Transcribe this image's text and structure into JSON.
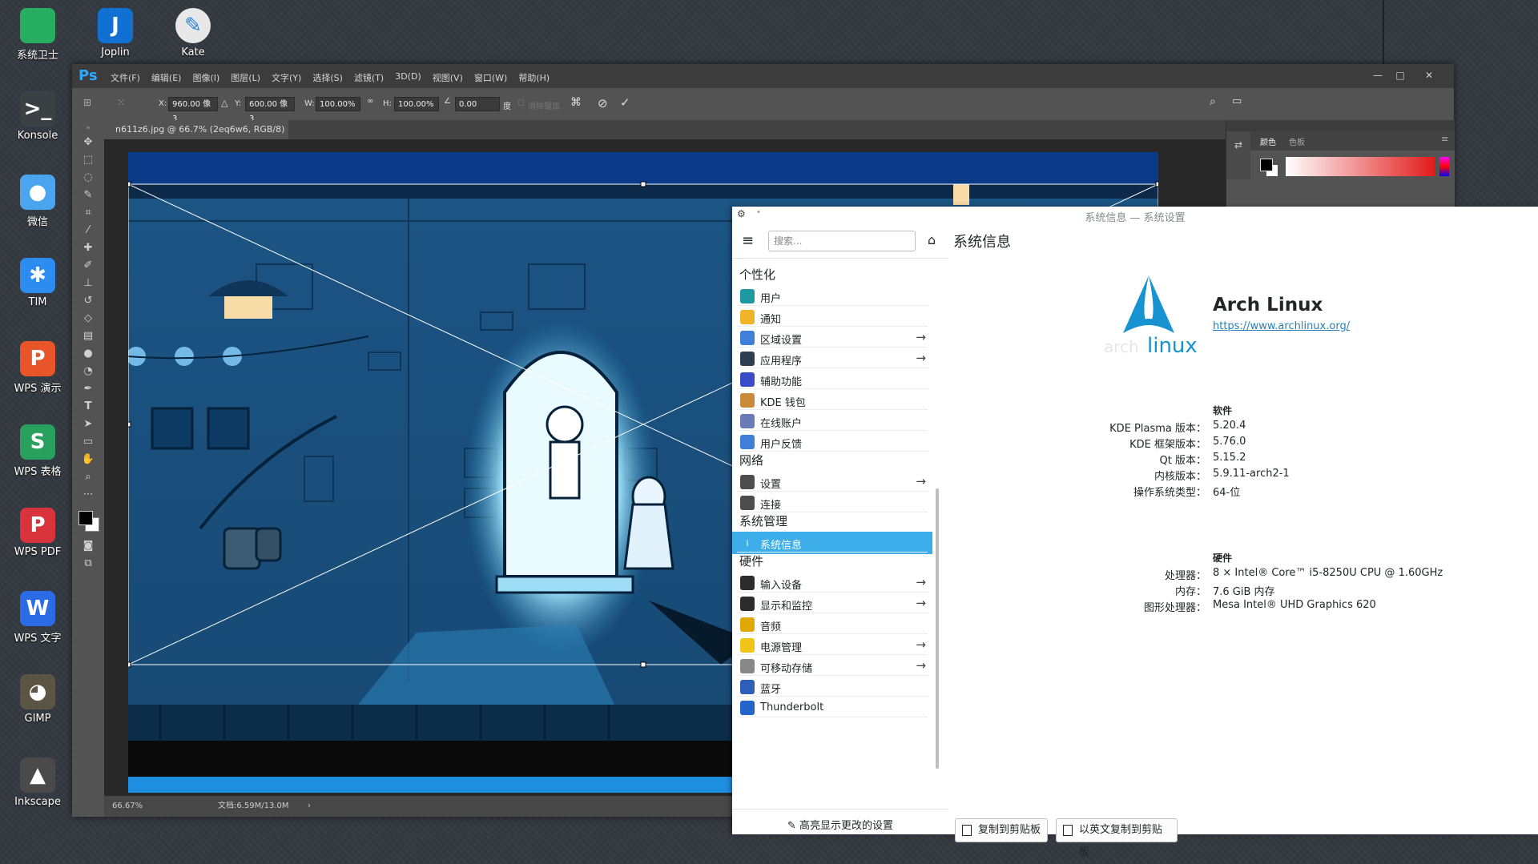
{
  "desktop": {
    "icons": [
      {
        "label": "系统卫士",
        "icon": "shield-folder-icon",
        "color": "#27ae60",
        "glyph": ""
      },
      {
        "label": "Konsole",
        "icon": "terminal-icon",
        "color": "#3b4045",
        "glyph": ">_"
      },
      {
        "label": "微信",
        "icon": "wechat-icon",
        "color": "#4aa4ee",
        "glyph": "●"
      },
      {
        "label": "TIM",
        "icon": "tim-icon",
        "color": "#2d8cf0",
        "glyph": "✱"
      },
      {
        "label": "WPS 演示",
        "icon": "wps-presentation-icon",
        "color": "#e8552a",
        "glyph": "P"
      },
      {
        "label": "WPS 表格",
        "icon": "wps-spreadsheet-icon",
        "color": "#2aa05e",
        "glyph": "S"
      },
      {
        "label": "WPS PDF",
        "icon": "wps-pdf-icon",
        "color": "#d9333b",
        "glyph": "P"
      },
      {
        "label": "WPS 文字",
        "icon": "wps-writer-icon",
        "color": "#2b6ce6",
        "glyph": "W"
      },
      {
        "label": "GIMP",
        "icon": "gimp-icon",
        "color": "#5c5543",
        "glyph": "◕"
      },
      {
        "label": "Inkscape",
        "icon": "inkscape-icon",
        "color": "#4a4a4a",
        "glyph": "▲"
      }
    ],
    "top_icons": [
      {
        "label": "Joplin",
        "icon": "joplin-icon",
        "color": "#1071d3",
        "glyph": "J"
      },
      {
        "label": "Kate",
        "icon": "kate-icon",
        "color": "#e8e8e8",
        "glyph": "✎"
      }
    ]
  },
  "photoshop": {
    "logo": "Ps",
    "menus": [
      "文件(F)",
      "编辑(E)",
      "图像(I)",
      "图层(L)",
      "文字(Y)",
      "选择(S)",
      "滤镜(T)",
      "3D(D)",
      "视图(V)",
      "窗口(W)",
      "帮助(H)"
    ],
    "options": {
      "x_label": "X:",
      "x_value": "960.00 像3",
      "y_label": "Y:",
      "y_value": "600.00 像3",
      "w_label": "W:",
      "w_value": "100.00%",
      "h_label": "H:",
      "h_value": "100.00%",
      "angle_value": "0.00",
      "angle_unit": "度",
      "antialias_label": "消除锯齿"
    },
    "document_tab": "n611z6.jpg @ 66.7% (2eq6w6, RGB/8)",
    "status": {
      "zoom": "66.67%",
      "doc": "文档:6.59M/13.0M"
    },
    "panel_tabs": [
      "颜色",
      "色板"
    ]
  },
  "settings": {
    "window_title": "系统信息 — 系统设置",
    "search_placeholder": "搜索...",
    "sidebar": {
      "sections": [
        {
          "title": "个性化",
          "items": [
            {
              "label": "用户",
              "icon": "user-icon",
              "color": "#1d99a1",
              "arrow": false
            },
            {
              "label": "通知",
              "icon": "bell-icon",
              "color": "#f0b429",
              "arrow": false
            },
            {
              "label": "区域设置",
              "icon": "locale-icon",
              "color": "#3d7fd9",
              "arrow": true
            },
            {
              "label": "应用程序",
              "icon": "apps-icon",
              "color": "#2c3e50",
              "arrow": true
            },
            {
              "label": "辅助功能",
              "icon": "accessibility-icon",
              "color": "#3a4bc7",
              "arrow": false
            },
            {
              "label": "KDE 钱包",
              "icon": "wallet-icon",
              "color": "#c98a3c",
              "arrow": false
            },
            {
              "label": "在线账户",
              "icon": "online-accounts-icon",
              "color": "#6b7bb8",
              "arrow": false
            },
            {
              "label": "用户反馈",
              "icon": "feedback-icon",
              "color": "#3d7fd9",
              "arrow": false
            }
          ]
        },
        {
          "title": "网络",
          "items": [
            {
              "label": "设置",
              "icon": "network-settings-icon",
              "color": "#4d4d4d",
              "arrow": true
            },
            {
              "label": "连接",
              "icon": "connections-icon",
              "color": "#4d4d4d",
              "arrow": false
            }
          ]
        },
        {
          "title": "系统管理",
          "items": [
            {
              "label": "系统信息",
              "icon": "info-icon",
              "color": "#3daee9",
              "arrow": false,
              "selected": true
            }
          ]
        },
        {
          "title": "硬件",
          "items": [
            {
              "label": "输入设备",
              "icon": "mouse-icon",
              "color": "#2c2c2c",
              "arrow": true
            },
            {
              "label": "显示和监控",
              "icon": "display-icon",
              "color": "#2c2c2c",
              "arrow": true
            },
            {
              "label": "音频",
              "icon": "audio-icon",
              "color": "#e0a800",
              "arrow": false
            },
            {
              "label": "电源管理",
              "icon": "power-icon",
              "color": "#f0c419",
              "arrow": true
            },
            {
              "label": "可移动存储",
              "icon": "usb-storage-icon",
              "color": "#888888",
              "arrow": true
            },
            {
              "label": "蓝牙",
              "icon": "bluetooth-icon",
              "color": "#2e5fb8",
              "arrow": false
            },
            {
              "label": "Thunderbolt",
              "icon": "thunderbolt-icon",
              "color": "#2266cc",
              "arrow": false
            }
          ]
        }
      ],
      "footer": "高亮显示更改的设置"
    },
    "page_title": "系统信息",
    "distro": {
      "name": "Arch Linux",
      "url": "https://www.archlinux.org/",
      "logo_text": "linux"
    },
    "software": {
      "title": "软件",
      "rows": [
        {
          "label": "KDE Plasma 版本：",
          "value": "5.20.4"
        },
        {
          "label": "KDE 框架版本：",
          "value": "5.76.0"
        },
        {
          "label": "Qt 版本：",
          "value": "5.15.2"
        },
        {
          "label": "内核版本：",
          "value": "5.9.11-arch2-1"
        },
        {
          "label": "操作系统类型：",
          "value": "64-位"
        }
      ]
    },
    "hardware": {
      "title": "硬件",
      "rows": [
        {
          "label": "处理器：",
          "value": "8 × Intel® Core™ i5-8250U CPU @ 1.60GHz"
        },
        {
          "label": "内存：",
          "value": "7.6 GiB 内存"
        },
        {
          "label": "图形处理器：",
          "value": "Mesa Intel® UHD Graphics 620"
        }
      ]
    },
    "buttons": {
      "copy": "复制到剪贴板",
      "copy_en": "以英文复制到剪贴板"
    },
    "accent": "#3daee9"
  }
}
